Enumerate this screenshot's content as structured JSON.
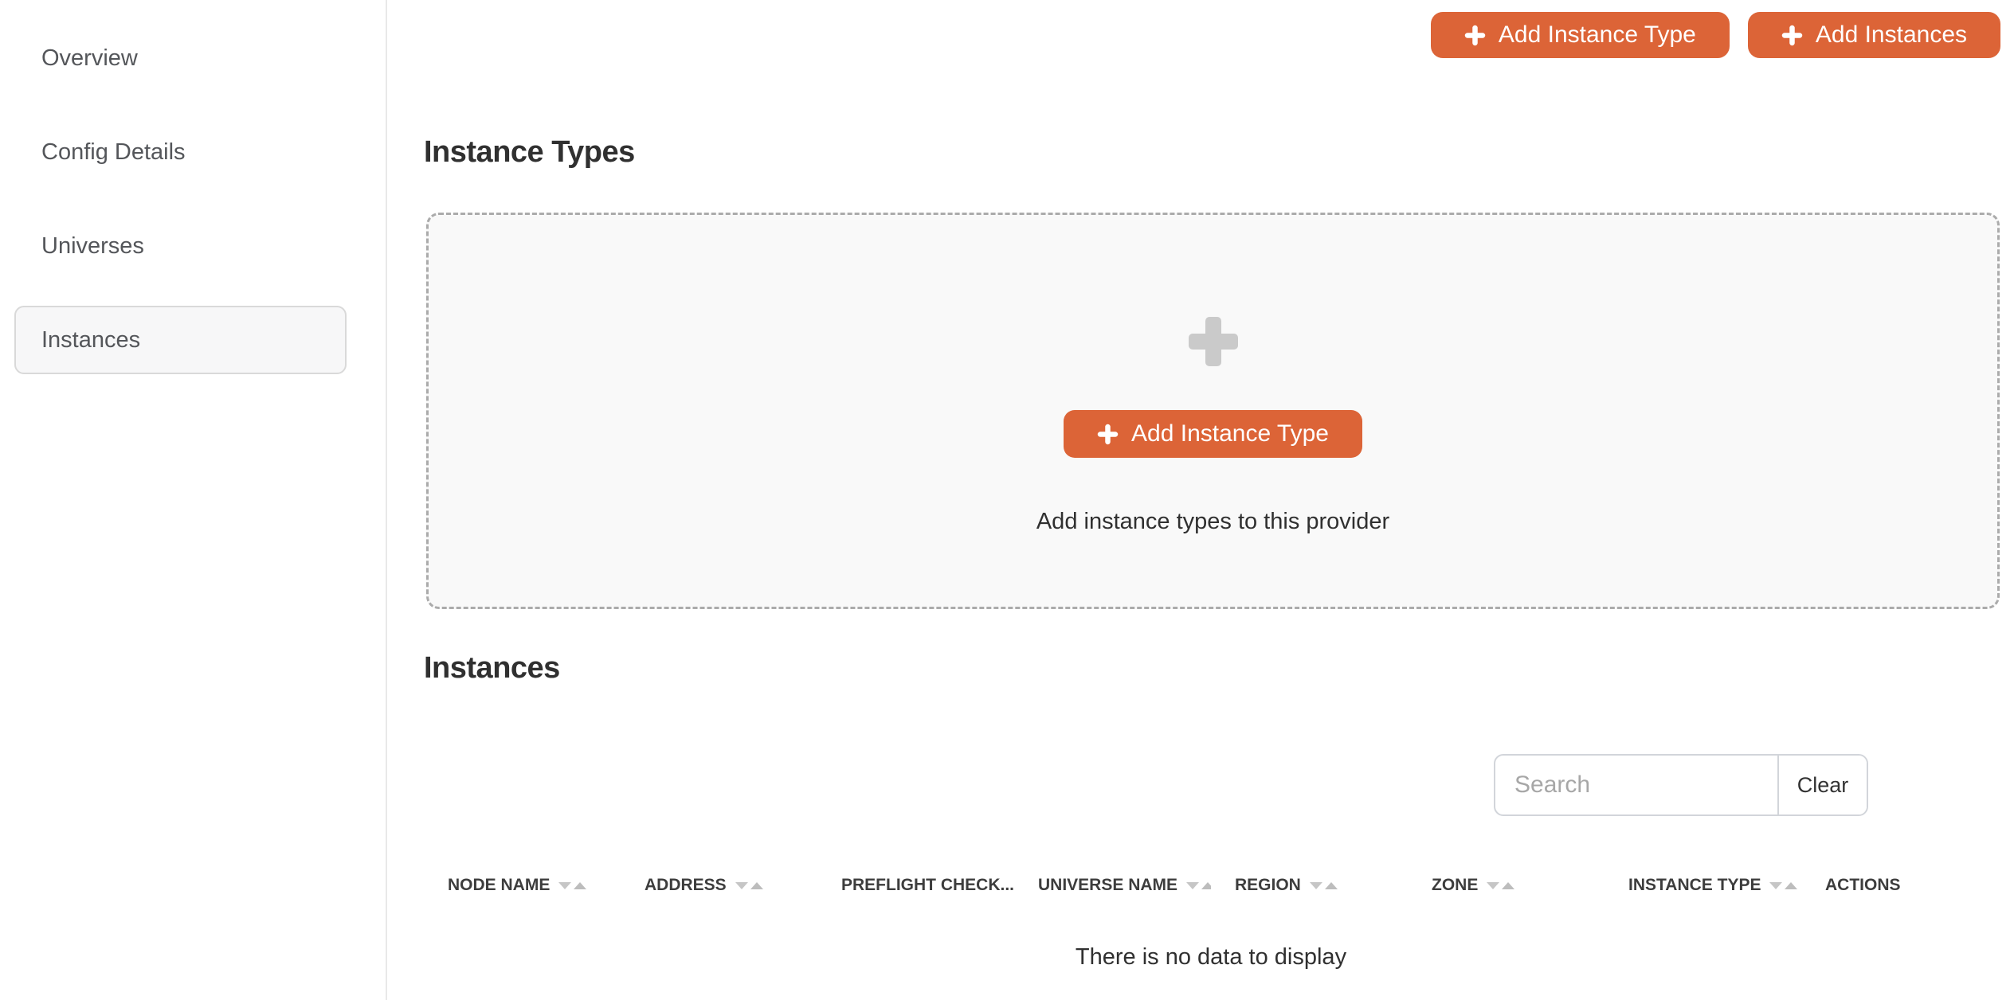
{
  "sidebar": {
    "items": [
      {
        "label": "Overview",
        "selected": false
      },
      {
        "label": "Config Details",
        "selected": false
      },
      {
        "label": "Universes",
        "selected": false
      },
      {
        "label": "Instances",
        "selected": true
      }
    ]
  },
  "toolbar": {
    "add_instance_type_label": "Add Instance Type",
    "add_instances_label": "Add Instances"
  },
  "instance_types_section": {
    "title": "Instance Types",
    "empty_panel": {
      "button_label": "Add Instance Type",
      "hint": "Add instance types to this provider"
    }
  },
  "instances_section": {
    "title": "Instances",
    "search": {
      "placeholder": "Search",
      "clear_label": "Clear"
    },
    "table": {
      "columns": [
        {
          "label": "NODE NAME",
          "sortable": true
        },
        {
          "label": "ADDRESS",
          "sortable": true
        },
        {
          "label": "PREFLIGHT CHECK...",
          "sortable": false
        },
        {
          "label": "UNIVERSE NAME",
          "sortable": true
        },
        {
          "label": "REGION",
          "sortable": true
        },
        {
          "label": "ZONE",
          "sortable": true
        },
        {
          "label": "INSTANCE TYPE",
          "sortable": true
        },
        {
          "label": "ACTIONS",
          "sortable": false
        }
      ],
      "empty_message": "There is no data to display"
    }
  },
  "colors": {
    "accent": "#dc6437",
    "panel_background": "#f9f9f9",
    "dashed_border": "#ababab",
    "plus_icon_gray": "#cacaca"
  }
}
